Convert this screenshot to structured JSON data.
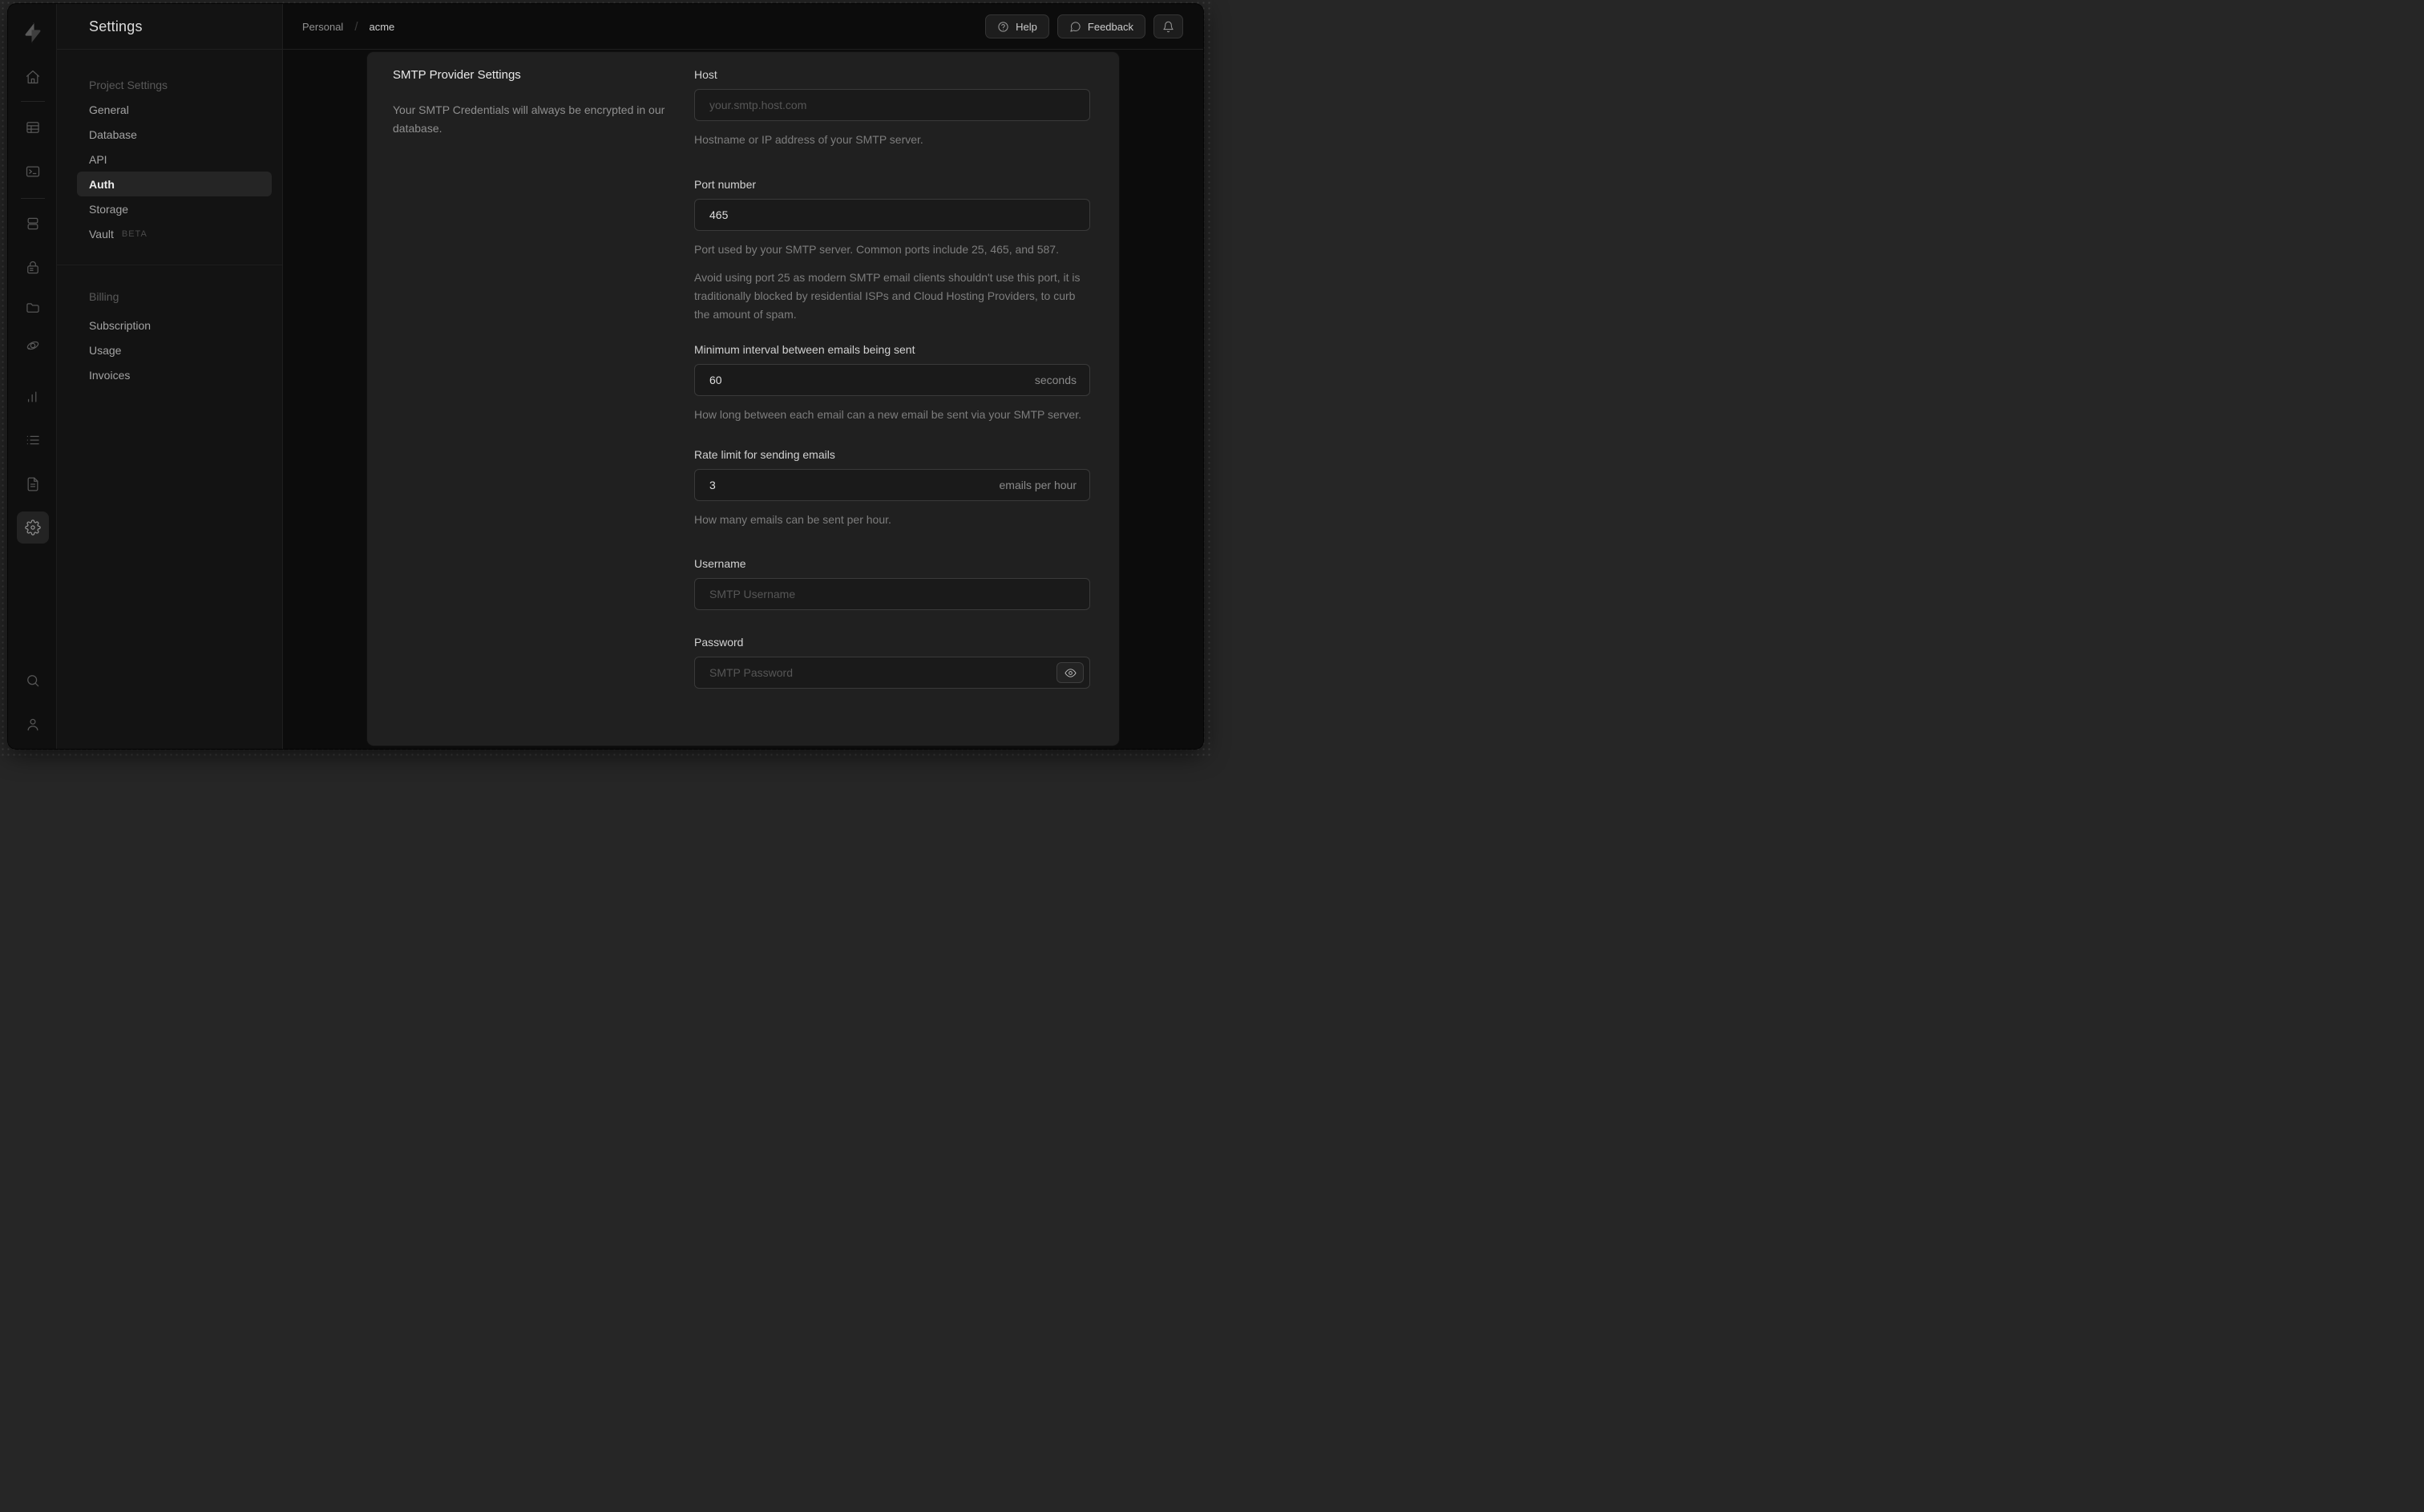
{
  "colors": {
    "desktop": "#272727",
    "window_bg": "#0c0c0c",
    "sidenav_bg": "#131313",
    "card_bg": "#202020",
    "input_bg": "#1a1a1a",
    "input_border": "#3a3a3a",
    "text_primary": "#e8e8e8",
    "text_muted": "#7d7d7d"
  },
  "rail": {
    "icons": [
      "supabase-logo",
      "home",
      "table-editor",
      "sql-editor",
      "database",
      "auth",
      "storage",
      "edge-functions",
      "reports",
      "logs",
      "api-docs",
      "settings",
      "search",
      "profile"
    ],
    "active_icon": "settings"
  },
  "nav": {
    "title": "Settings",
    "groups": [
      {
        "header": "Project Settings",
        "items": [
          {
            "label": "General"
          },
          {
            "label": "Database"
          },
          {
            "label": "API"
          },
          {
            "label": "Auth",
            "active": true
          },
          {
            "label": "Storage"
          },
          {
            "label": "Vault",
            "badge": "BETA"
          }
        ]
      },
      {
        "header": "Billing",
        "items": [
          {
            "label": "Subscription"
          },
          {
            "label": "Usage"
          },
          {
            "label": "Invoices"
          }
        ]
      }
    ]
  },
  "topbar": {
    "breadcrumb": {
      "org": "Personal",
      "separator": "/",
      "project": "acme"
    },
    "help_label": "Help",
    "feedback_label": "Feedback"
  },
  "form": {
    "title": "SMTP Provider Settings",
    "description": "Your SMTP Credentials will always be encrypted in our database.",
    "fields": {
      "host": {
        "label": "Host",
        "placeholder": "your.smtp.host.com",
        "helper": "Hostname or IP address of your SMTP server."
      },
      "port": {
        "label": "Port number",
        "value": "465",
        "helper": "Port used by your SMTP server. Common ports include 25, 465, and 587.",
        "note": "Avoid using port 25 as modern SMTP email clients shouldn't use this port, it is traditionally blocked by residential ISPs and Cloud Hosting Providers, to curb the amount of spam."
      },
      "interval": {
        "label": "Minimum interval between emails being sent",
        "value": "60",
        "suffix": "seconds",
        "helper": "How long between each email can a new email be sent via your SMTP server."
      },
      "rate": {
        "label": "Rate limit for sending emails",
        "value": "3",
        "suffix": "emails per hour",
        "helper": "How many emails can be sent per hour."
      },
      "username": {
        "label": "Username",
        "placeholder": "SMTP Username"
      },
      "password": {
        "label": "Password",
        "placeholder": "SMTP Password"
      }
    }
  }
}
